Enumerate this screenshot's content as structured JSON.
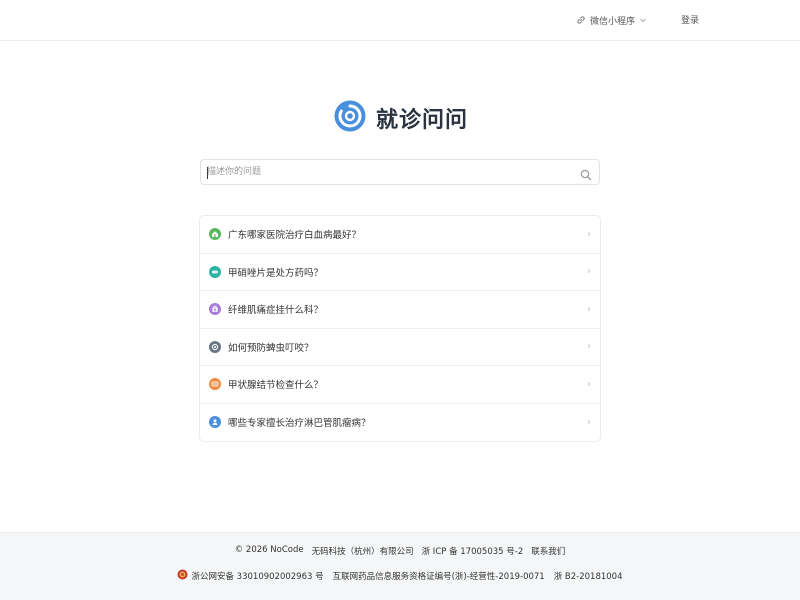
{
  "header": {
    "mini_program_label": "微信小程序",
    "login_label": "登录"
  },
  "brand": {
    "title": "就诊问问"
  },
  "search": {
    "placeholder": "描述你的问题"
  },
  "questions": [
    {
      "text": "广东哪家医院治疗白血病最好？",
      "icon": "hospital-icon",
      "color": "#5cb85c"
    },
    {
      "text": "甲硝唑片是处方药吗？",
      "icon": "pill-icon",
      "color": "#2bb5a0"
    },
    {
      "text": "纤维肌痛症挂什么科？",
      "icon": "clinic-bag-icon",
      "color": "#a77bd8"
    },
    {
      "text": "如何预防蜱虫叮咬？",
      "icon": "shield-icon",
      "color": "#6b7685"
    },
    {
      "text": "甲状腺结节检查什么？",
      "icon": "scan-icon",
      "color": "#ef8b3b"
    },
    {
      "text": "哪些专家擅长治疗淋巴管肌瘤病？",
      "icon": "doctor-icon",
      "color": "#4a8fdd"
    }
  ],
  "footer": {
    "copyright": "© 2026 NoCode",
    "company": "无码科技（杭州）有限公司",
    "icp": "浙 ICP 备 17005035 号-2",
    "contact": "联系我们",
    "police": "浙公网安备 33010902002963 号",
    "drug_license": "互联网药品信息服务资格证编号(浙)-经营性-2019-0071",
    "b2": "浙 B2-20181004"
  },
  "colors": {
    "brand": "#4a8fdd",
    "border": "#ececec",
    "footer_bg": "#f5f6f7"
  }
}
